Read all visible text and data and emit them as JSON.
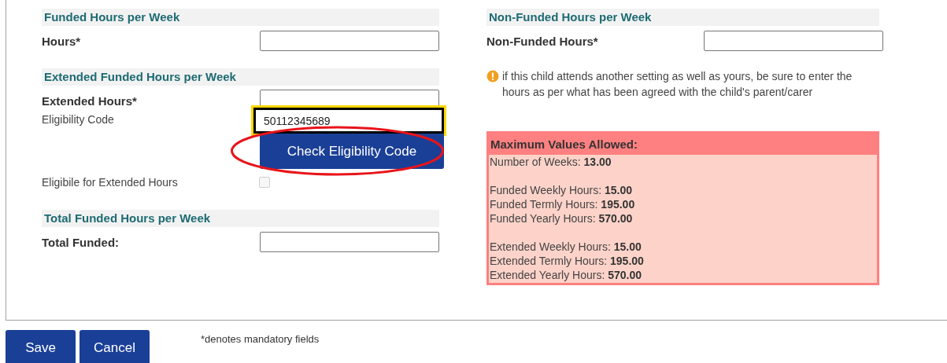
{
  "funded": {
    "heading": "Funded Hours per Week",
    "label": "Hours*"
  },
  "extended": {
    "heading": "Extended Funded Hours per Week",
    "label": "Extended Hours*",
    "code_label": "Eligibility Code",
    "code_value": "50112345689",
    "code_focused": true,
    "check_button": "Check Eligibility Code",
    "eligible_label": "Eligibile for Extended Hours",
    "eligible_checked": false,
    "eligible_disabled": true
  },
  "total": {
    "heading": "Total Funded Hours per Week",
    "label": "Total Funded:"
  },
  "non_funded": {
    "heading": "Non-Funded Hours per Week",
    "label": "Non-Funded Hours*"
  },
  "notice": "if this child attends another setting as well as yours, be sure to enter the hours as per what has been agreed with the child's parent/carer",
  "max_values": {
    "title": "Maximum Values Allowed:",
    "groups": [
      [
        {
          "label": "Number of Weeks:",
          "value": "13.00"
        }
      ],
      [
        {
          "label": "Funded Weekly Hours:",
          "value": "15.00"
        },
        {
          "label": "Funded Termly Hours:",
          "value": "195.00"
        },
        {
          "label": "Funded Yearly Hours:",
          "value": "570.00"
        }
      ],
      [
        {
          "label": "Extended Weekly Hours:",
          "value": "15.00"
        },
        {
          "label": "Extended Termly Hours:",
          "value": "195.00"
        },
        {
          "label": "Extended Yearly Hours:",
          "value": "570.00"
        }
      ]
    ]
  },
  "buttons": [
    "Save",
    "Cancel"
  ],
  "footnote": "*denotes mandatory fields"
}
